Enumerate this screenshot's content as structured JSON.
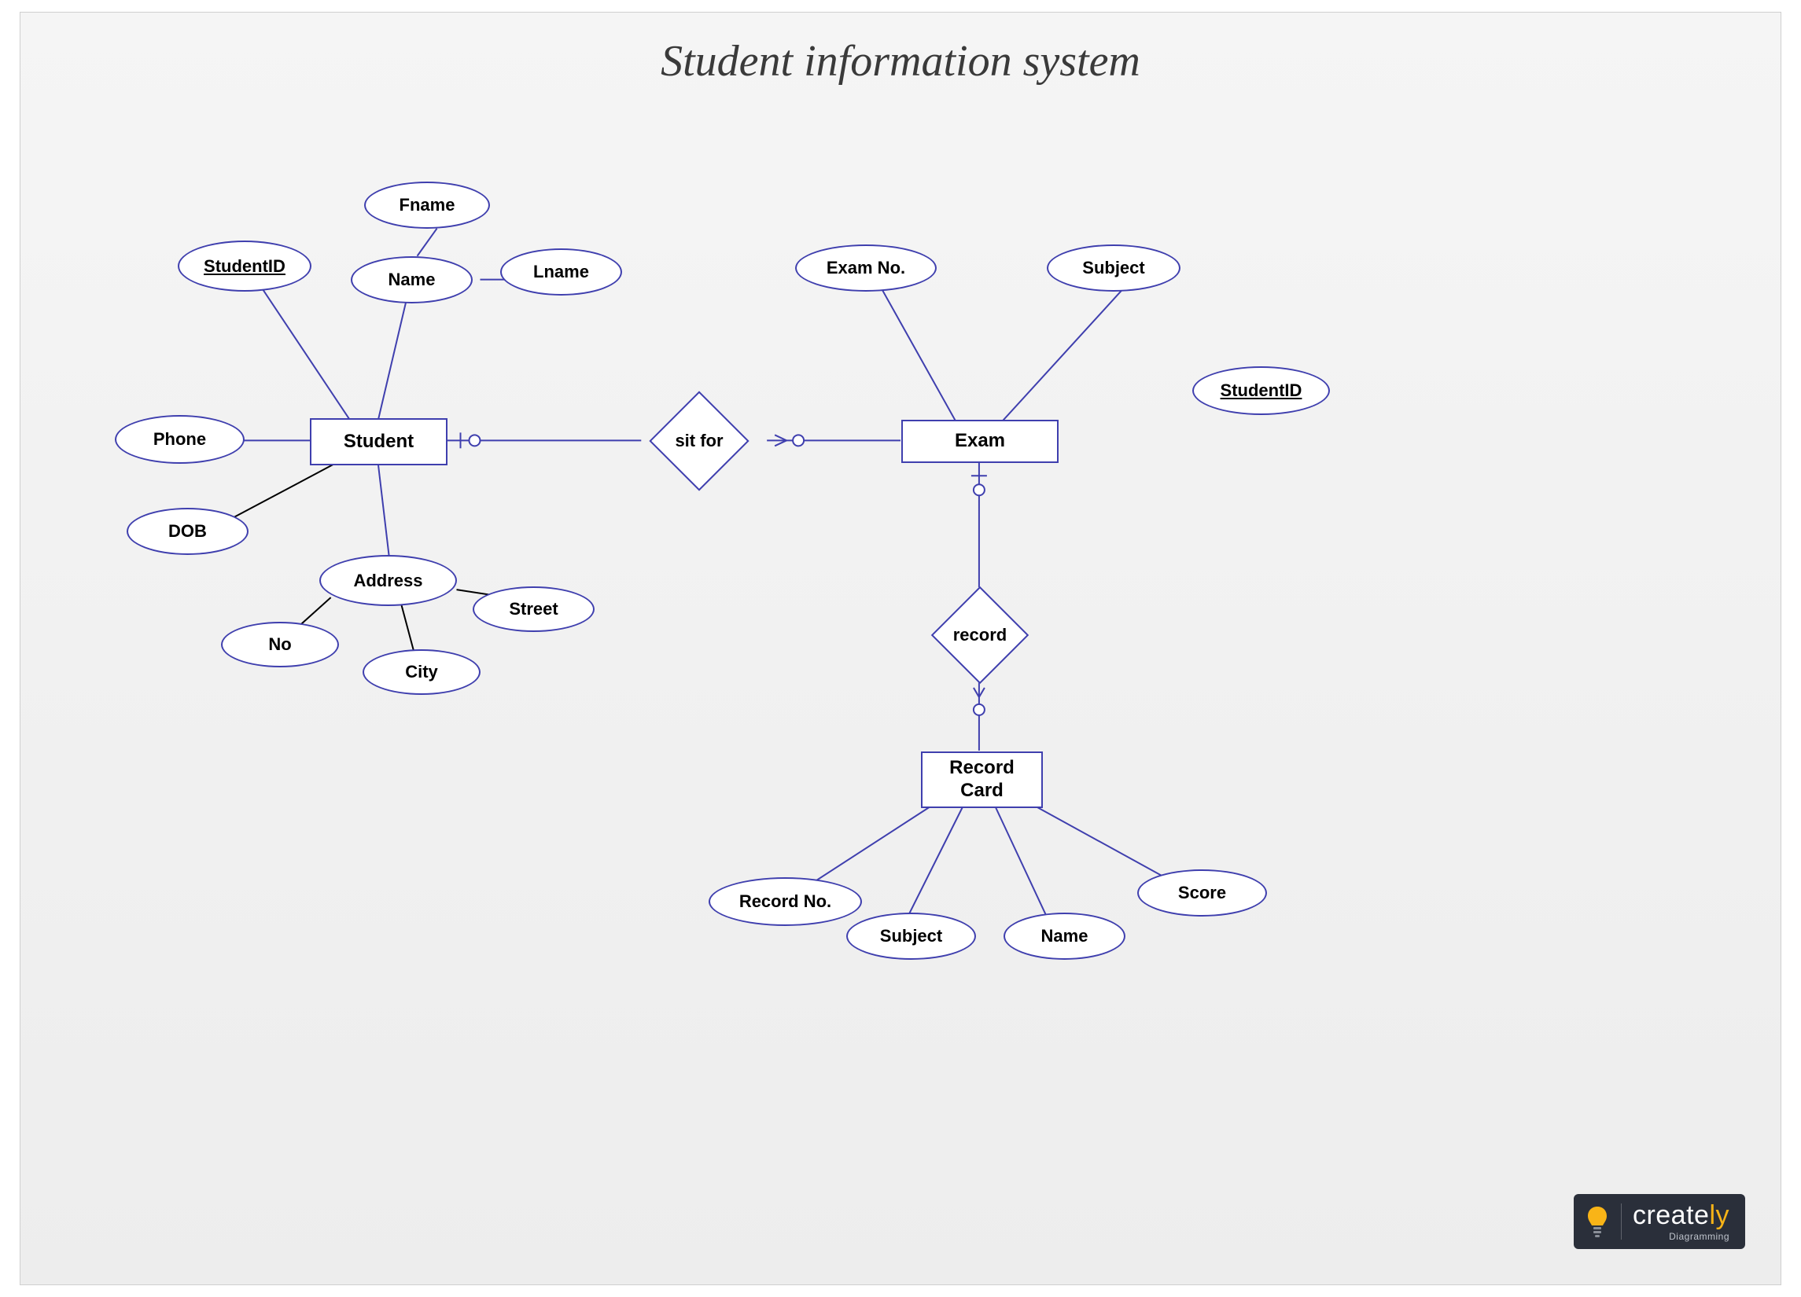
{
  "title": "Student information system",
  "entities": {
    "student": "Student",
    "exam": "Exam",
    "record_card": "Record\nCard"
  },
  "relationships": {
    "sit_for": "sit for",
    "record": "record"
  },
  "attributes": {
    "student_id": "StudentID",
    "fname": "Fname",
    "name": "Name",
    "lname": "Lname",
    "phone": "Phone",
    "dob": "DOB",
    "address": "Address",
    "no": "No",
    "city": "City",
    "street": "Street",
    "exam_no": "Exam No.",
    "subject_exam": "Subject",
    "student_id_exam": "StudentID",
    "record_no": "Record No.",
    "subject_rc": "Subject",
    "name_rc": "Name",
    "score": "Score"
  },
  "brand": {
    "name_a": "create",
    "name_b": "ly",
    "tag": "Diagramming"
  },
  "colors": {
    "stroke": "#3f3fae",
    "stroke_thin": "#000000"
  }
}
